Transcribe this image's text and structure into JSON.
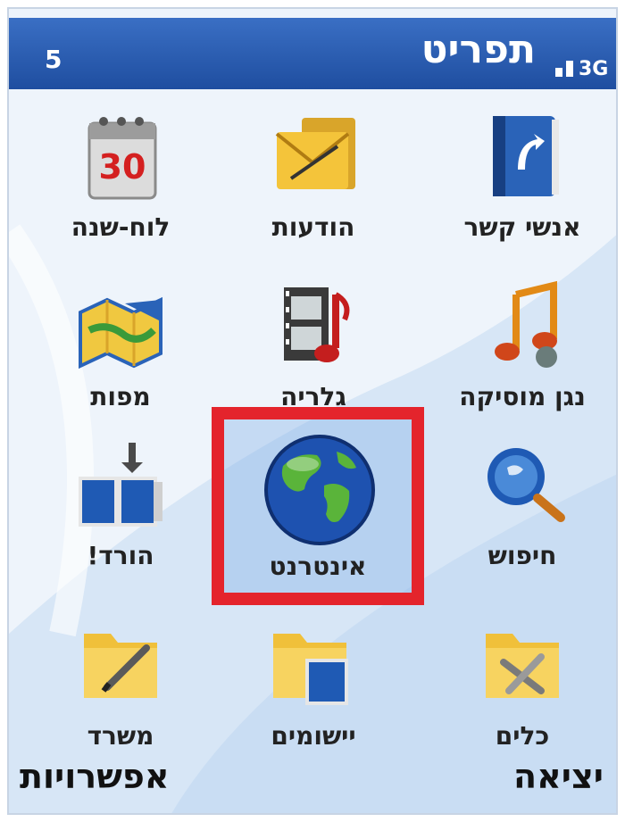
{
  "header": {
    "title": "תפריט",
    "page_number": "5"
  },
  "menu": {
    "items": [
      {
        "label": "אנשי קשר",
        "icon": "contacts-icon"
      },
      {
        "label": "הודעות",
        "icon": "messages-envelope-icon"
      },
      {
        "label": "לוח-שנה",
        "icon": "calendar-icon",
        "icon_text": "30"
      },
      {
        "label": "נגן מוסיקה",
        "icon": "music-note-icon"
      },
      {
        "label": "גלריה",
        "icon": "gallery-film-icon"
      },
      {
        "label": "מפות",
        "icon": "map-icon"
      },
      {
        "label": "חיפוש",
        "icon": "search-magnifier-icon"
      },
      {
        "label": "אינטרנט",
        "icon": "globe-icon",
        "selected": true
      },
      {
        "label": "הורד!",
        "icon": "download-icon"
      },
      {
        "label": "כלים",
        "icon": "tools-folder-icon"
      },
      {
        "label": "יישומים",
        "icon": "applications-folder-icon"
      },
      {
        "label": "משרד",
        "icon": "office-folder-icon"
      }
    ]
  },
  "softkeys": {
    "left": "אפשרויות",
    "right": "יציאה"
  },
  "colors": {
    "titlebar": "#2a5cb4",
    "selection": "#e4242c",
    "background": "#eef4fb"
  }
}
